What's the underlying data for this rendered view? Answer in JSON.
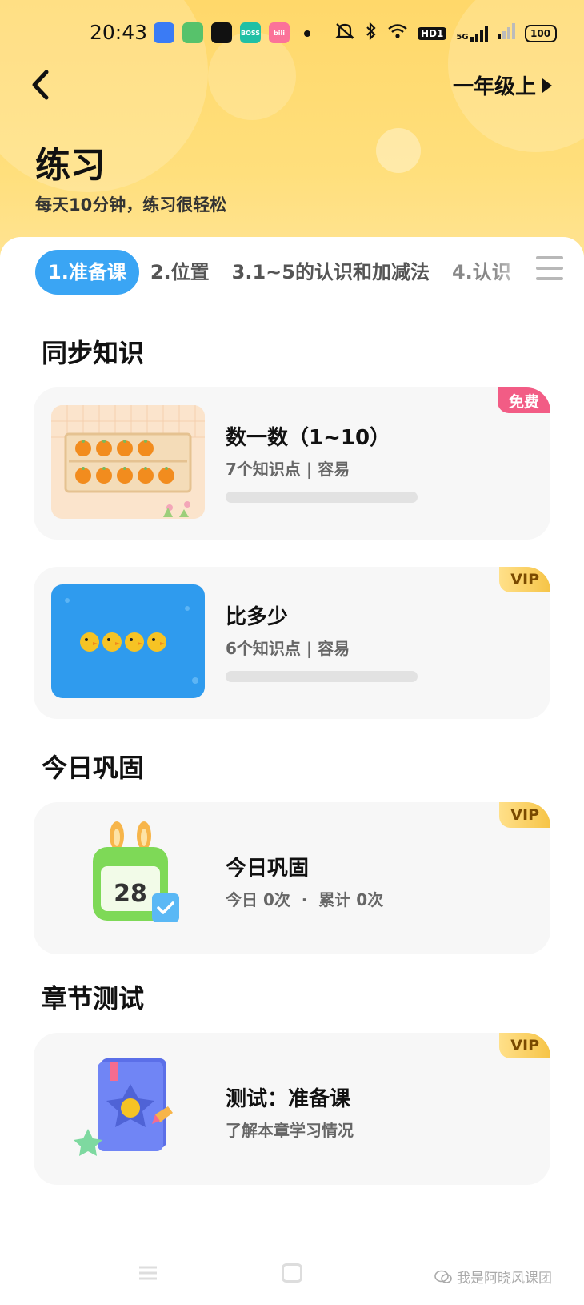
{
  "status_bar": {
    "time": "20:43",
    "apps": [
      {
        "icon": "app-icon-1",
        "text": "",
        "color": "#3a7bf5"
      },
      {
        "icon": "app-icon-2",
        "text": "",
        "color": "#57c26b"
      },
      {
        "icon": "wechat-icon",
        "text": "",
        "color": "#111111"
      },
      {
        "icon": "boss-app-icon",
        "text": "BOSS",
        "color": "#21c0a5"
      },
      {
        "icon": "bilibili-app-icon",
        "text": "bili",
        "color": "#fb7299"
      }
    ],
    "hd_label": "HD1",
    "network_label": "5G",
    "battery": "100"
  },
  "header": {
    "grade": "一年级上",
    "title": "练习",
    "subtitle": "每天10分钟，练习很轻松"
  },
  "tabs": [
    {
      "label": "1.准备课",
      "active": true
    },
    {
      "label": "2.位置",
      "active": false
    },
    {
      "label": "3.1~5的认识和加减法",
      "active": false
    },
    {
      "label": "4.认识",
      "active": false
    }
  ],
  "sections": {
    "sync": "同步知识",
    "review": "今日巩固",
    "test": "章节测试"
  },
  "cards": {
    "count": {
      "title": "数一数（1~10）",
      "meta": "7个知识点 | 容易",
      "badge": "免费",
      "progress": 0
    },
    "compare": {
      "title": "比多少",
      "meta": "6个知识点 | 容易",
      "badge": "VIP",
      "progress": 0
    },
    "review": {
      "title": "今日巩固",
      "meta": "今日 0次  ·  累计 0次",
      "badge": "VIP",
      "calendar_day": "28"
    },
    "test": {
      "title": "测试：准备课",
      "meta": "了解本章学习情况",
      "badge": "VIP"
    }
  },
  "watermark": "我是阿晓风课团",
  "colors": {
    "header_yellow": "#ffd86a",
    "tab_active": "#3aa5f4",
    "badge_free": "#f25c85",
    "badge_vip": "#f6c447"
  }
}
